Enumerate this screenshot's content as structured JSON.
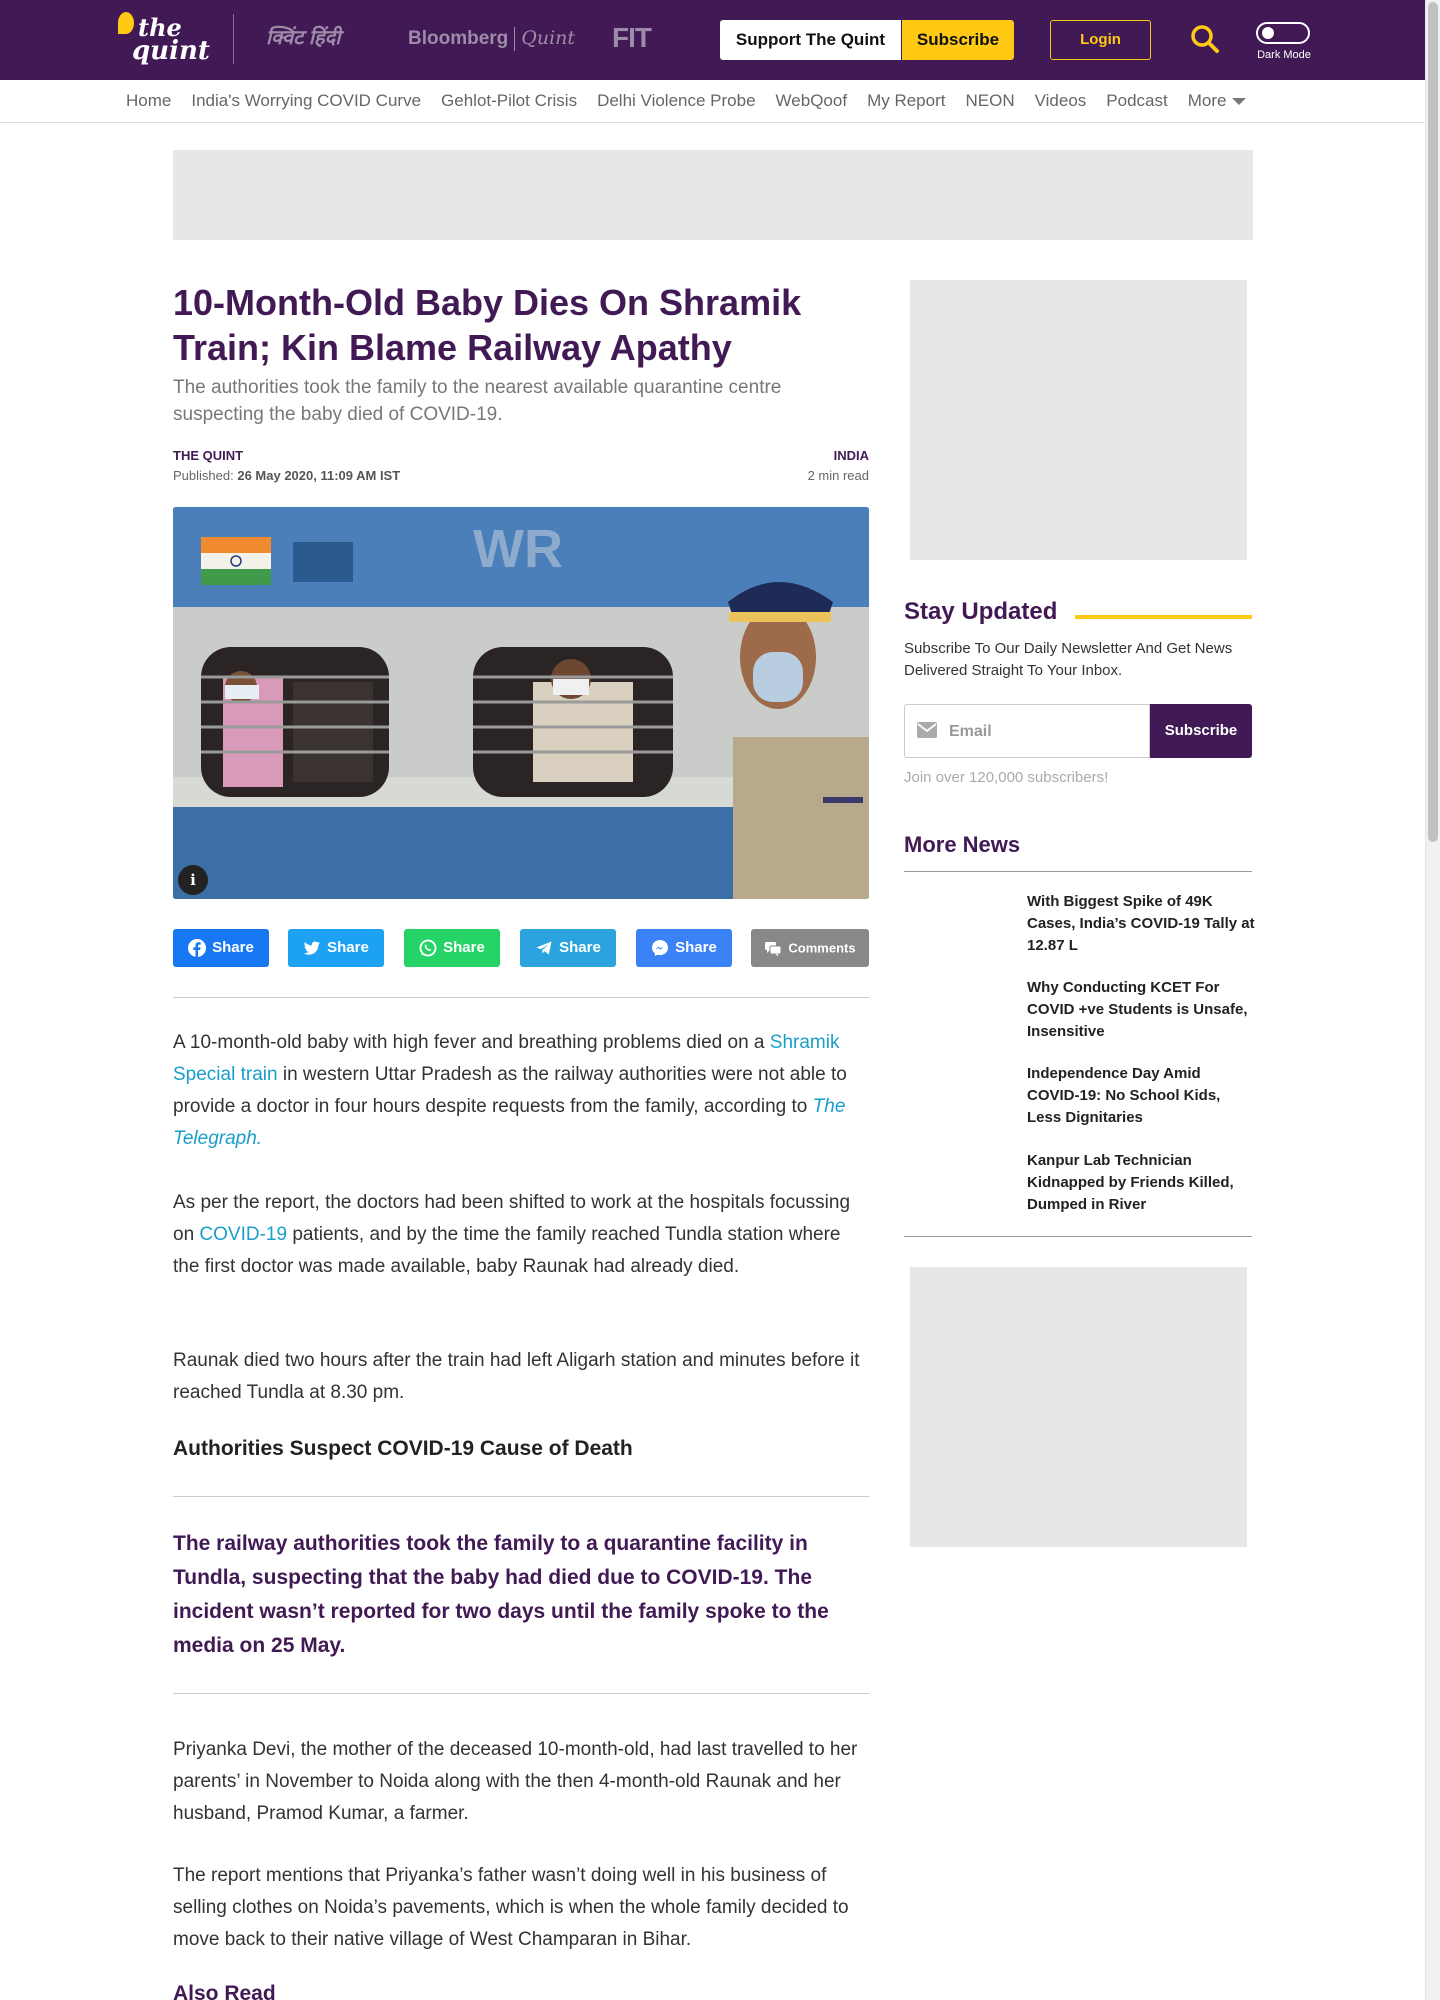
{
  "header": {
    "logo_line1": "the",
    "logo_line2": "quint",
    "sister_sites": [
      "क्विंट हिंदी",
      "Bloomberg",
      "Quint",
      "FIT"
    ],
    "support_label": "Support The Quint",
    "subscribe_label": "Subscribe",
    "login_label": "Login",
    "dark_mode_label": "Dark Mode",
    "brand_color": "#411A55",
    "accent_color": "#FFC914"
  },
  "nav": {
    "items": [
      "Home",
      "India's Worrying COVID Curve",
      "Gehlot-Pilot Crisis",
      "Delhi Violence Probe",
      "WebQoof",
      "My Report",
      "NEON",
      "Videos",
      "Podcast",
      "More"
    ]
  },
  "article": {
    "headline": "10-Month-Old Baby Dies On Shramik Train; Kin Blame Railway Apathy",
    "subheadline": "The authorities took the family to the nearest available quarantine centre suspecting the baby died of COVID-19.",
    "author": "THE QUINT",
    "published_label": "Published:",
    "published_date": "26 May 2020, 11:09 AM IST",
    "section": "INDIA",
    "read_time": "2 min read",
    "image_info_label": "i",
    "share": {
      "facebook": "Share",
      "twitter": "Share",
      "whatsapp": "Share",
      "telegram": "Share",
      "messenger": "Share",
      "comments": "Comments"
    },
    "p1": {
      "before": "A 10-month-old baby with high fever and breathing problems died on a ",
      "link": "Shramik Special train",
      "middle": " in western Uttar Pradesh as the railway authorities were not able to provide a doctor in four hours despite requests from the family, according to ",
      "link2": "The Telegraph."
    },
    "p2": {
      "before": "As per the report, the doctors had been shifted to work at the hospitals focussing on ",
      "link": "COVID-19",
      "after": " patients, and by the time the family reached Tundla station where the first doctor was made available, baby Raunak had already died."
    },
    "p3": "Raunak died two hours after the train had left Aligarh station and minutes before it reached Tundla at 8.30 pm.",
    "subheading": "Authorities Suspect COVID-19 Cause of Death",
    "pullquote": "The railway authorities took the family to a quarantine facility in Tundla, suspecting that the baby had died due to COVID-19. The incident wasn’t reported for two days until the family spoke to the media on 25 May.",
    "p4": "Priyanka Devi, the mother of the deceased 10-month-old, had last travelled to her parents’ in November to Noida along with the then 4-month-old Raunak and her husband, Pramod Kumar, a farmer.",
    "p5": "The report mentions that Priyanka’s father wasn’t doing well in his business of selling clothes on Noida’s pavements, which is when the whole family decided to move back to their native village of West Champaran in Bihar.",
    "also_read": "Also Read"
  },
  "sidebar": {
    "stay_title": "Stay Updated",
    "stay_text": "Subscribe To Our Daily Newsletter And Get News Delivered Straight To Your Inbox.",
    "email_placeholder": "Email",
    "subscribe_label": "Subscribe",
    "join_text": "Join over 120,000 subscribers!",
    "more_news_title": "More News",
    "more_news": [
      "With Biggest Spike of 49K Cases, India’s COVID-19 Tally at 12.87 L",
      "Why Conducting KCET For COVID +ve Students is Unsafe, Insensitive",
      "Independence Day Amid COVID-19: No School Kids, Less Dignitaries",
      "Kanpur Lab Technician Kidnapped by Friends Killed, Dumped in River"
    ]
  }
}
